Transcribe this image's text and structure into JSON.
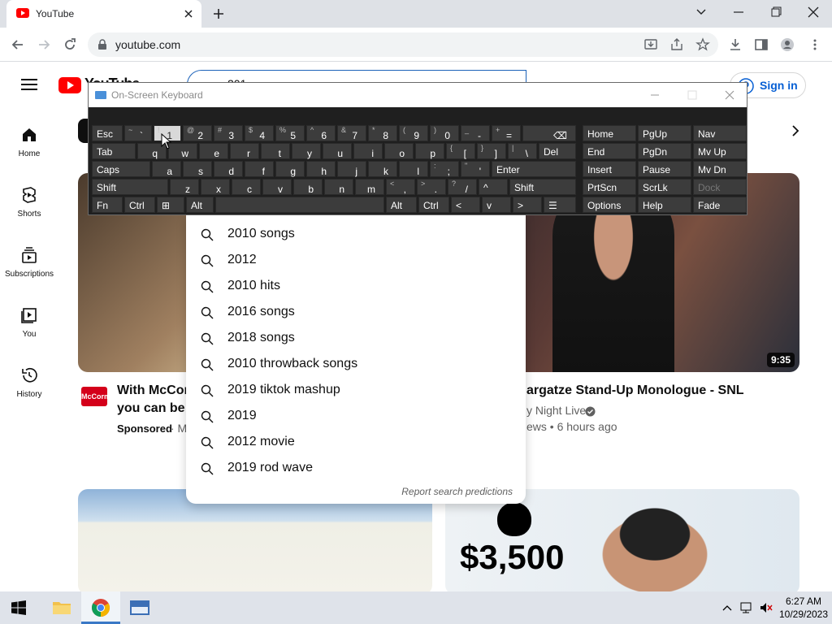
{
  "browser": {
    "tab_title": "YouTube",
    "url": "youtube.com"
  },
  "youtube": {
    "logo_text": "YouTube",
    "search_value": "201",
    "sign_in": "Sign in",
    "rail": [
      {
        "label": "Home",
        "icon": "home-icon"
      },
      {
        "label": "Shorts",
        "icon": "shorts-icon"
      },
      {
        "label": "Subscriptions",
        "icon": "subscriptions-icon"
      },
      {
        "label": "You",
        "icon": "you-icon"
      },
      {
        "label": "History",
        "icon": "history-icon"
      }
    ],
    "suggestions": [
      "2010 songs",
      "2012",
      "2010 hits",
      "2016 songs",
      "2018 songs",
      "2010 throwback songs",
      "2019 tiktok mashup",
      "2019",
      "2012 movie",
      "2019 rod wave"
    ],
    "report": "Report search predictions",
    "video1": {
      "title_line1": "With McCor",
      "title_line2": "you can be s",
      "sponsored": "Sponsored",
      "meta_rest": "· M",
      "channel_logo": "McCormick"
    },
    "video2": {
      "title": "argatze Stand-Up Monologue - SNL",
      "channel": "y Night Live",
      "meta": "ews • 6 hours ago",
      "duration": "9:35"
    },
    "video4": {
      "price": "$3,500"
    }
  },
  "osk": {
    "title": "On-Screen Keyboard",
    "row1": [
      [
        "Esc",
        ""
      ],
      [
        "`",
        "~"
      ],
      [
        "1",
        "!"
      ],
      [
        "2",
        "@"
      ],
      [
        "3",
        "#"
      ],
      [
        "4",
        "$"
      ],
      [
        "5",
        "%"
      ],
      [
        "6",
        "^"
      ],
      [
        "7",
        "&"
      ],
      [
        "8",
        "*"
      ],
      [
        "9",
        "("
      ],
      [
        "0",
        ")"
      ],
      [
        "-",
        "_"
      ],
      [
        "=",
        "+"
      ],
      [
        "⌫",
        ""
      ]
    ],
    "row2": [
      [
        "Tab",
        ""
      ],
      [
        "q",
        ""
      ],
      [
        "w",
        ""
      ],
      [
        "e",
        ""
      ],
      [
        "r",
        ""
      ],
      [
        "t",
        ""
      ],
      [
        "y",
        ""
      ],
      [
        "u",
        ""
      ],
      [
        "i",
        ""
      ],
      [
        "o",
        ""
      ],
      [
        "p",
        ""
      ],
      [
        "[",
        "{"
      ],
      [
        "]",
        "}"
      ],
      [
        "\\",
        "|"
      ],
      [
        "Del",
        ""
      ]
    ],
    "row3": [
      [
        "Caps",
        ""
      ],
      [
        "a",
        ""
      ],
      [
        "s",
        ""
      ],
      [
        "d",
        ""
      ],
      [
        "f",
        ""
      ],
      [
        "g",
        ""
      ],
      [
        "h",
        ""
      ],
      [
        "j",
        ""
      ],
      [
        "k",
        ""
      ],
      [
        "l",
        ""
      ],
      [
        ";",
        ":"
      ],
      [
        "'",
        "\""
      ],
      [
        "Enter",
        ""
      ]
    ],
    "row4": [
      [
        "Shift",
        ""
      ],
      [
        "z",
        ""
      ],
      [
        "x",
        ""
      ],
      [
        "c",
        ""
      ],
      [
        "v",
        ""
      ],
      [
        "b",
        ""
      ],
      [
        "n",
        ""
      ],
      [
        "m",
        ""
      ],
      [
        ",",
        "<"
      ],
      [
        ".",
        ">"
      ],
      [
        "/",
        "?"
      ],
      [
        "^",
        ""
      ],
      [
        "Shift",
        ""
      ]
    ],
    "row5": [
      [
        "Fn",
        ""
      ],
      [
        "Ctrl",
        ""
      ],
      [
        "⊞",
        ""
      ],
      [
        "Alt",
        ""
      ],
      [
        "",
        ""
      ],
      [
        "Alt",
        ""
      ],
      [
        "Ctrl",
        ""
      ],
      [
        "<",
        ""
      ],
      [
        "v",
        ""
      ],
      [
        ">",
        ""
      ],
      [
        "☰",
        ""
      ]
    ],
    "nav": [
      [
        "Home",
        "PgUp",
        "Nav"
      ],
      [
        "End",
        "PgDn",
        "Mv Up"
      ],
      [
        "Insert",
        "Pause",
        "Mv Dn"
      ],
      [
        "PrtScn",
        "ScrLk",
        "Dock"
      ],
      [
        "Options",
        "Help",
        "Fade"
      ]
    ]
  },
  "taskbar": {
    "time": "6:27 AM",
    "date": "10/29/2023"
  },
  "colors": {
    "yt_red": "#ff0000",
    "link_blue": "#065fd4",
    "osk_bg": "#1f1f1f",
    "osk_key": "#3c3c3c"
  }
}
